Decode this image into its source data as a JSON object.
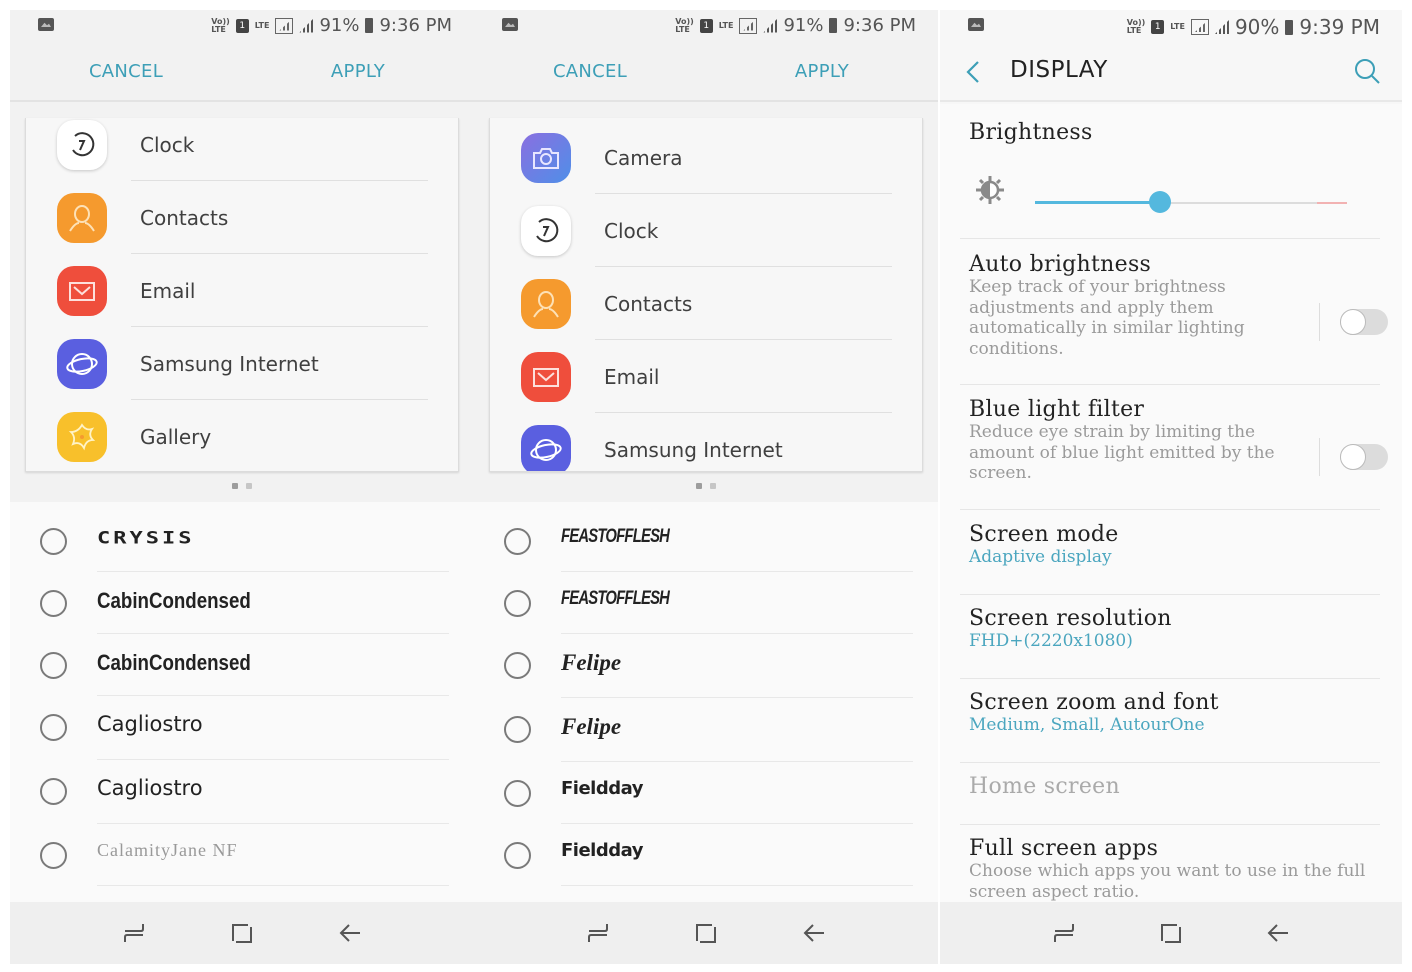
{
  "screens": [
    {
      "status": {
        "battery": "91%",
        "time": "9:36 PM",
        "volte": "Vo)) LTE",
        "sim": "1",
        "lte": "LTE"
      },
      "header": {
        "cancel_label": "CANCEL",
        "apply_label": "APPLY"
      },
      "apps": [
        {
          "label": "Clock",
          "icon": "clock-icon"
        },
        {
          "label": "Contacts",
          "icon": "contacts-icon"
        },
        {
          "label": "Email",
          "icon": "email-icon"
        },
        {
          "label": "Samsung Internet",
          "icon": "samsung-internet-icon"
        },
        {
          "label": "Gallery",
          "icon": "gallery-icon"
        }
      ],
      "page_indicator": {
        "current": 1,
        "total": 2
      },
      "fonts": [
        {
          "name": "CRYSIS",
          "selected": false
        },
        {
          "name": "CabinCondensed",
          "selected": false
        },
        {
          "name": "CabinCondensed",
          "selected": false
        },
        {
          "name": "Cagliostro",
          "selected": false
        },
        {
          "name": "Cagliostro",
          "selected": false
        },
        {
          "name": "CalamityJane NF",
          "selected": false
        }
      ]
    },
    {
      "status": {
        "battery": "91%",
        "time": "9:36 PM",
        "volte": "Vo)) LTE",
        "sim": "1",
        "lte": "LTE"
      },
      "header": {
        "cancel_label": "CANCEL",
        "apply_label": "APPLY"
      },
      "apps": [
        {
          "label": "Camera",
          "icon": "camera-icon"
        },
        {
          "label": "Clock",
          "icon": "clock-icon"
        },
        {
          "label": "Contacts",
          "icon": "contacts-icon"
        },
        {
          "label": "Email",
          "icon": "email-icon"
        },
        {
          "label": "Samsung Internet",
          "icon": "samsung-internet-icon"
        }
      ],
      "page_indicator": {
        "current": 1,
        "total": 2
      },
      "fonts": [
        {
          "name": "FEASTOFFLESH",
          "selected": false
        },
        {
          "name": "FEASTOFFLESH",
          "selected": false
        },
        {
          "name": "Felipe",
          "selected": false
        },
        {
          "name": "Felipe",
          "selected": false
        },
        {
          "name": "Fieldday",
          "selected": false
        },
        {
          "name": "Fieldday",
          "selected": false
        }
      ]
    }
  ],
  "display": {
    "status": {
      "battery": "90%",
      "time": "9:39 PM",
      "volte": "Vo)) LTE",
      "sim": "1",
      "lte": "LTE"
    },
    "title": "DISPLAY",
    "brightness": {
      "title": "Brightness",
      "value_percent": 40
    },
    "auto_brightness": {
      "title": "Auto brightness",
      "description": "Keep track of your brightness adjustments and apply them automatically in similar lighting conditions.",
      "enabled": false
    },
    "blue_light": {
      "title": "Blue light filter",
      "description": "Reduce eye strain by limiting the amount of blue light emitted by the screen.",
      "enabled": false
    },
    "screen_mode": {
      "title": "Screen mode",
      "value": "Adaptive display"
    },
    "screen_resolution": {
      "title": "Screen resolution",
      "value": "FHD+(2220x1080)"
    },
    "screen_zoom": {
      "title": "Screen zoom and font",
      "value": "Medium, Small, AutourOne"
    },
    "home_screen": {
      "title": "Home screen"
    },
    "full_screen_apps": {
      "title": "Full screen apps",
      "description": "Choose which apps you want to use in the full screen aspect ratio."
    }
  },
  "navbar": {
    "recent": "recent-apps",
    "home": "home",
    "back": "back"
  },
  "colors": {
    "accent": "#3d9fb7",
    "slider": "#54b8de",
    "link": "#4ba6bf"
  }
}
